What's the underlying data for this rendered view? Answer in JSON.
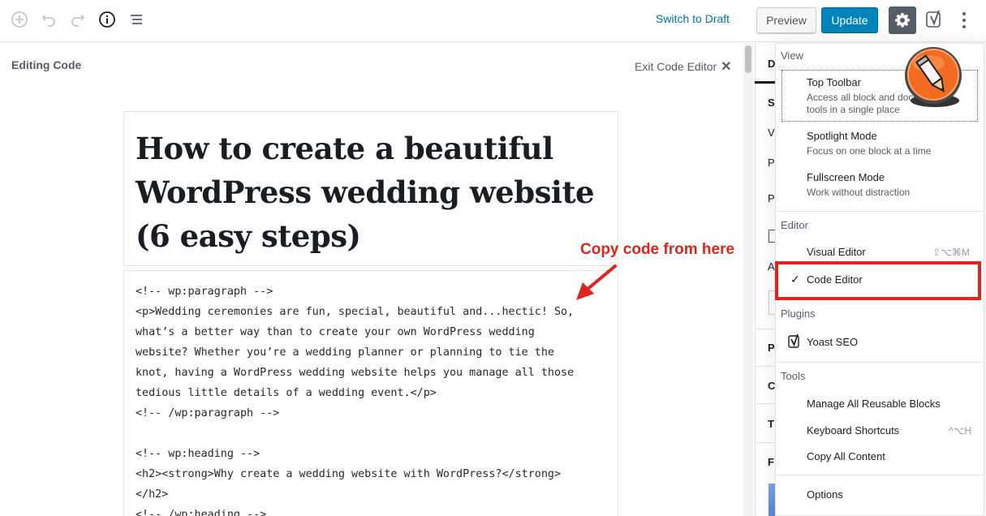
{
  "toolbar": {
    "switch_to_draft": "Switch to Draft",
    "preview": "Preview",
    "update": "Update",
    "icons": [
      "add-block-icon",
      "undo-icon",
      "redo-icon",
      "info-icon",
      "outline-icon",
      "gear-icon",
      "yoast-icon",
      "more-options-icon"
    ]
  },
  "editor": {
    "editing_label": "Editing Code",
    "exit_label": "Exit Code Editor",
    "title_lines": [
      "How to create a beautiful",
      "WordPress wedding website",
      "(6 easy steps)"
    ],
    "code_lines": [
      "<!-- wp:paragraph -->",
      "<p>Wedding ceremonies are fun, special, beautiful and...hectic! So,",
      "what’s a better way than to create your own WordPress wedding",
      "website? Whether you’re a wedding planner or planning to tie the",
      "knot, having a WordPress wedding website helps you manage all those",
      "tedious little details of a wedding event.</p>",
      "<!-- /wp:paragraph -->",
      "",
      "<!-- wp:heading -->",
      "<h2><strong>Why create a wedding website with WordPress?</strong>",
      "</h2>",
      "<!-- /wp:heading -->"
    ]
  },
  "annotation": {
    "text": "Copy code from here",
    "color": "#e0241c"
  },
  "sidebar_peek": [
    "D",
    "S",
    "V",
    "P",
    "P",
    "A",
    "P",
    "C",
    "T",
    "F"
  ],
  "menu": {
    "view_label": "View",
    "view_items": [
      {
        "label": "Top Toolbar",
        "desc": "Access all block and document tools in a single place"
      },
      {
        "label": "Spotlight Mode",
        "desc": "Focus on one block at a time"
      },
      {
        "label": "Fullscreen Mode",
        "desc": "Work without distraction"
      }
    ],
    "editor_label": "Editor",
    "visual_editor": "Visual Editor",
    "visual_editor_shortcut": "⇧⌥⌘M",
    "code_editor": "Code Editor",
    "checkmark": "✓",
    "plugins_label": "Plugins",
    "yoast_seo": "Yoast SEO",
    "tools_label": "Tools",
    "manage_blocks": "Manage All Reusable Blocks",
    "keyboard_shortcuts": "Keyboard Shortcuts",
    "keyboard_shortcuts_shortcut": "^⌥H",
    "copy_all": "Copy All Content",
    "options": "Options"
  },
  "colors": {
    "primary_button": "#0085ba",
    "link": "#0073aa",
    "highlight": "#e0241c",
    "settings_active": "#555d66"
  }
}
